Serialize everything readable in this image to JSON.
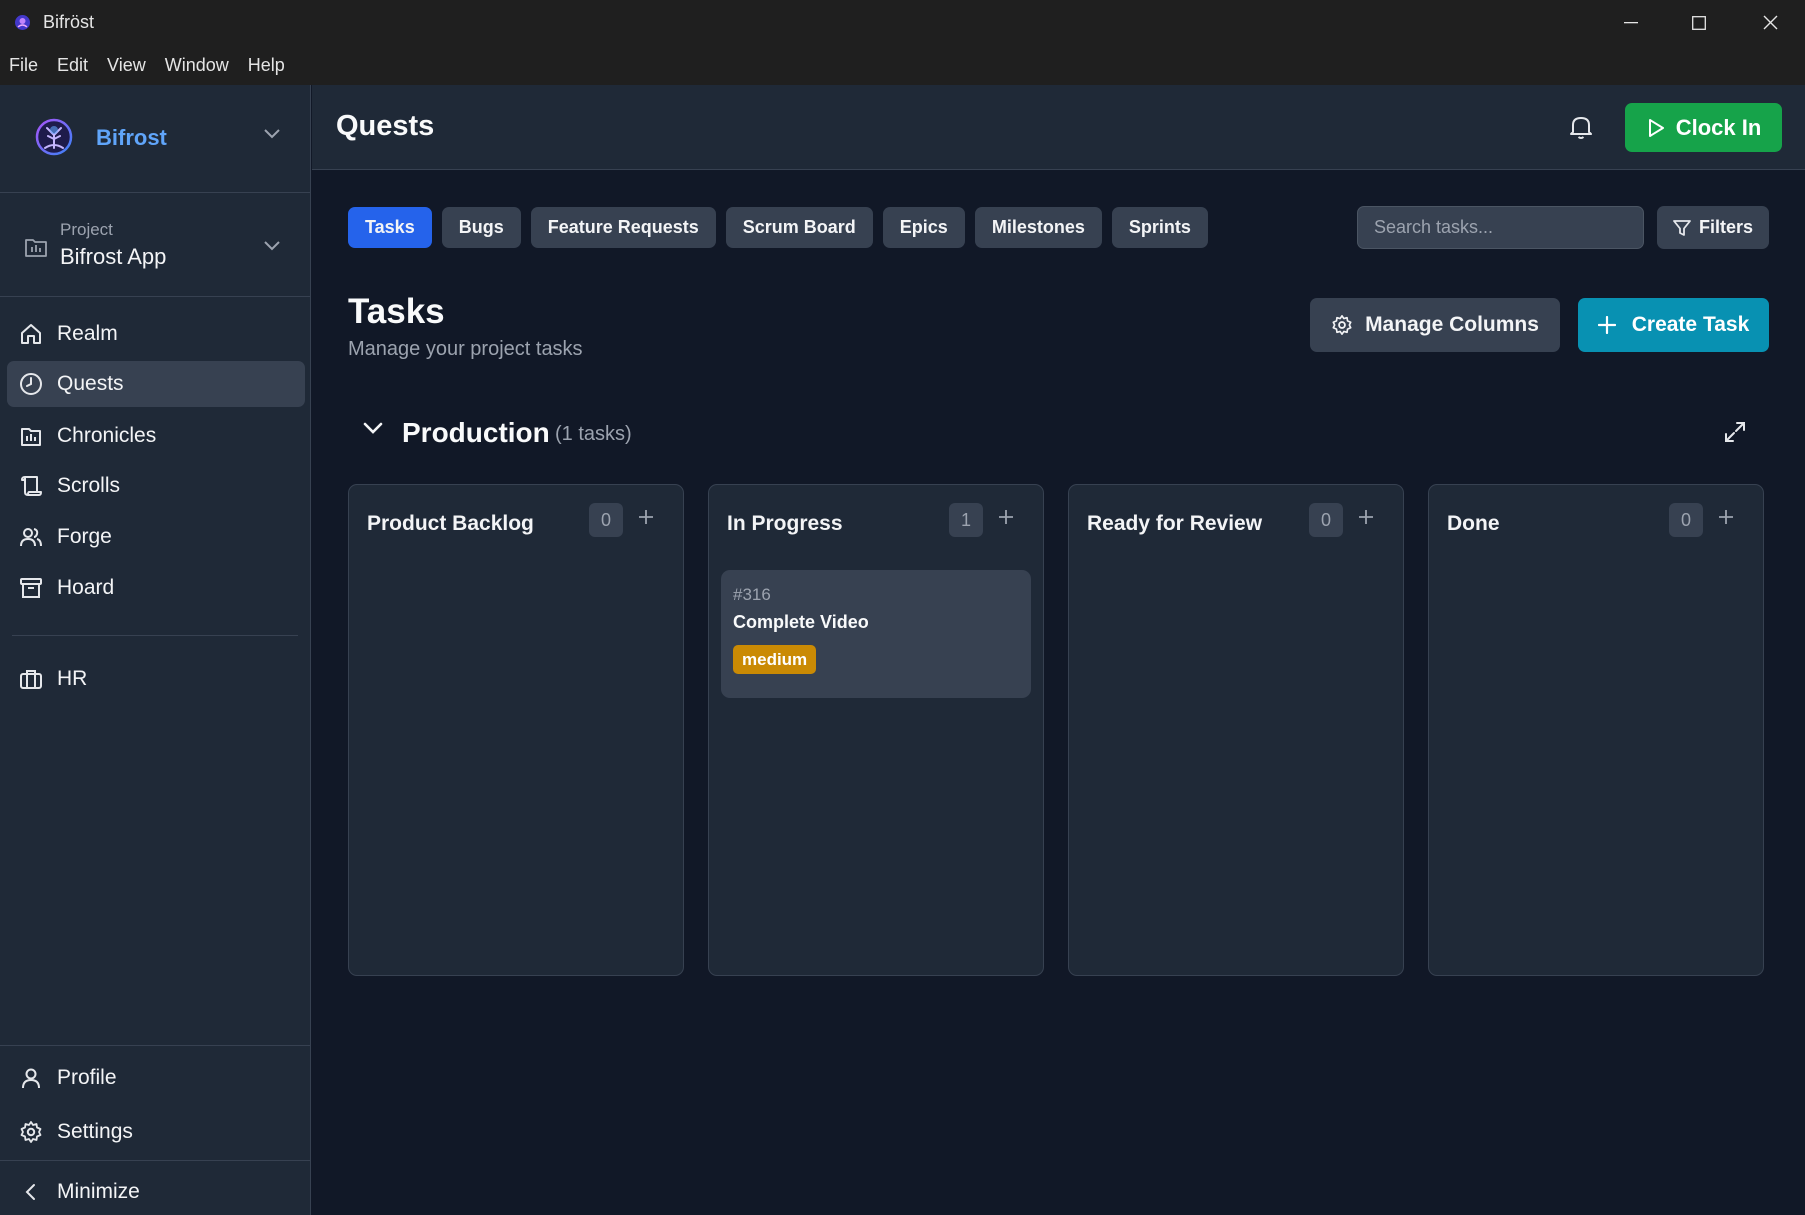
{
  "window": {
    "title": "Bifröst"
  },
  "menu": [
    "File",
    "Edit",
    "View",
    "Window",
    "Help"
  ],
  "sidebar": {
    "org_name": "Bifrost",
    "project_caption": "Project",
    "project_name": "Bifrost App",
    "nav": [
      {
        "label": "Realm",
        "icon": "home-icon"
      },
      {
        "label": "Quests",
        "icon": "clock-icon",
        "active": true
      },
      {
        "label": "Chronicles",
        "icon": "calendar-icon"
      },
      {
        "label": "Scrolls",
        "icon": "scroll-icon"
      },
      {
        "label": "Forge",
        "icon": "users-icon"
      },
      {
        "label": "Hoard",
        "icon": "archive-icon"
      },
      {
        "label": "HR",
        "icon": "briefcase-icon"
      }
    ],
    "profile": "Profile",
    "settings": "Settings",
    "minimize": "Minimize"
  },
  "header": {
    "title": "Quests",
    "clock_in": "Clock In"
  },
  "tabs": [
    "Tasks",
    "Bugs",
    "Feature Requests",
    "Scrum Board",
    "Epics",
    "Milestones",
    "Sprints"
  ],
  "active_tab": "Tasks",
  "search": {
    "placeholder": "Search tasks..."
  },
  "filters_label": "Filters",
  "section": {
    "title": "Tasks",
    "subtitle": "Manage your project tasks",
    "manage_columns": "Manage Columns",
    "create_task": "Create Task"
  },
  "group": {
    "name": "Production",
    "count_text": "(1 tasks)"
  },
  "columns": [
    {
      "title": "Product Backlog",
      "count": "0"
    },
    {
      "title": "In Progress",
      "count": "1"
    },
    {
      "title": "Ready for Review",
      "count": "0"
    },
    {
      "title": "Done",
      "count": "0"
    }
  ],
  "card": {
    "id": "#316",
    "title": "Complete Video",
    "priority": "medium"
  },
  "colors": {
    "accent_blue": "#2563eb",
    "clock_in_green": "#16a34a",
    "create_cyan": "#0891b2",
    "medium_badge": "#ca8a04",
    "org_name_blue": "#60a5fa"
  }
}
